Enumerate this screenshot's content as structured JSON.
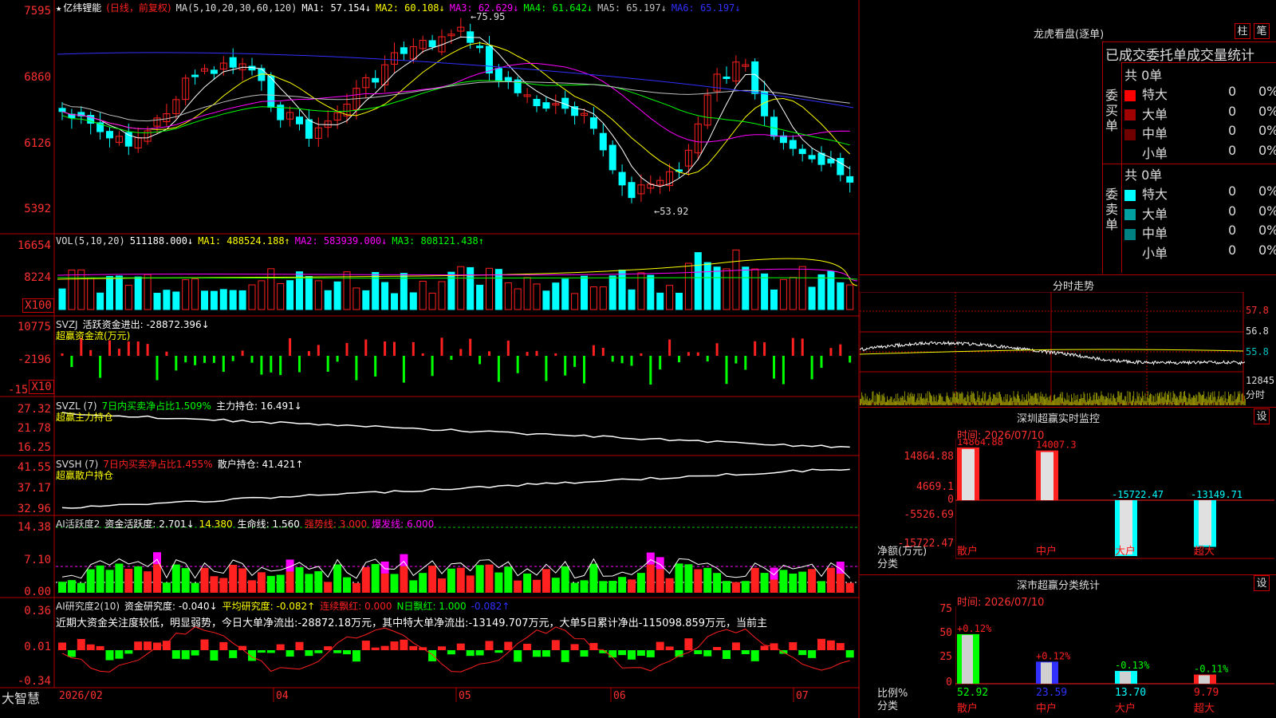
{
  "colors": {
    "up": "#ff2020",
    "down": "#00ffff",
    "bg": "#000000",
    "grid": "#b00000",
    "ma1": "#ffffff",
    "ma2": "#ffff00",
    "ma3": "#ff00ff",
    "ma4": "#00ff00",
    "ma5": "#c0c0c0",
    "ma6": "#3030ff"
  },
  "kline": {
    "title_star": "★",
    "stock": "亿纬锂能",
    "mode": "(日线，前复权)",
    "ma_label": "MA(5,10,20,30,60,120)",
    "ma_values": [
      "MA1: 57.154↓",
      "MA2: 60.108↓",
      "MA3: 62.629↓",
      "MA4: 61.642↓",
      "MA5: 65.197↓",
      "MA6: 65.197↓"
    ],
    "y_ticks": [
      "7595",
      "6860",
      "6126",
      "5392"
    ],
    "high_label": "75.95",
    "low_label": "53.92"
  },
  "vol": {
    "label": "VOL(5,10,20)",
    "value": "511188.000↓",
    "ma": [
      "MA1: 488524.188↑",
      "MA2: 583939.000↓",
      "MA3: 808121.438↑"
    ],
    "y_ticks": [
      "16654",
      "8224"
    ],
    "unit": "X100"
  },
  "svzj": {
    "label": "SVZJ",
    "desc": "活跃资金进出: -28872.396↓",
    "sub": "超赢资金流(万元)",
    "y_ticks": [
      "10775",
      "-2196",
      "-15"
    ],
    "unit": "X10"
  },
  "svzl": {
    "label": "SVZL (7)",
    "desc": "7日内买卖净占比1.509%",
    "hold": "主力持仓: 16.491↓",
    "sub": "超赢主力持仓",
    "y_ticks": [
      "27.32",
      "21.78",
      "16.25"
    ]
  },
  "svsh": {
    "label": "SVSH (7)",
    "desc": "7日内买卖净占比1.455%",
    "hold": "散户持仓: 41.421↑",
    "sub": "超赢散户持仓",
    "y_ticks": [
      "41.55",
      "37.17",
      "32.96"
    ]
  },
  "ai_active": {
    "label": "AI活跃度2",
    "items": [
      "资金活跃度: 2.701↓",
      "14.380",
      "生命线: 1.560",
      "强势线: 3.000",
      "爆发线: 6.000"
    ],
    "y_ticks": [
      "14.38",
      "7.10",
      "0.00"
    ]
  },
  "ai_research": {
    "label": "AI研究度2(10)",
    "items": [
      "资金研究度: -0.040↓",
      "平均研究度: -0.082↑",
      "连续飘红: 0.000",
      "N日飘红: 1.000",
      "-0.082↑"
    ],
    "commentary": "近期大资金关注度较低，明显弱势，今日大单净流出:-28872.18万元，其中特大单净流出:-13149.707万元，大单5日累计净出-115098.859万元，当前主",
    "y_ticks": [
      "0.36",
      "0.01",
      "-0.34"
    ]
  },
  "x_axis": {
    "brand": "大智慧",
    "labels": [
      "2026/02",
      "04",
      "05",
      "06",
      "07"
    ]
  },
  "longhu": {
    "title": "龙虎看盘(逐单)",
    "btn_zhu": "柱",
    "btn_bi": "笔",
    "header": "已成交委托单成交量统计",
    "buy_label": "委买单",
    "sell_label": "委卖单",
    "buy_total": "共 0单",
    "sell_total": "共 0单",
    "buy_rows": [
      {
        "name": "特大",
        "qty": "0",
        "pct": "0%",
        "color": "#ff0000"
      },
      {
        "name": "大单",
        "qty": "0",
        "pct": "0%",
        "color": "#a00000"
      },
      {
        "name": "中单",
        "qty": "0",
        "pct": "0%",
        "color": "#700000"
      },
      {
        "name": "小单",
        "qty": "0",
        "pct": "0%",
        "color": ""
      }
    ],
    "sell_rows": [
      {
        "name": "特大",
        "qty": "0",
        "pct": "0%",
        "color": "#00ffff"
      },
      {
        "name": "大单",
        "qty": "0",
        "pct": "0%",
        "color": "#00a0a0"
      },
      {
        "name": "中单",
        "qty": "0",
        "pct": "0%",
        "color": "#008080"
      },
      {
        "name": "小单",
        "qty": "0",
        "pct": "0%",
        "color": ""
      }
    ]
  },
  "fenshi": {
    "title": "分时走势",
    "right_ticks": [
      "57.8",
      "56.8",
      "55.8",
      "12845"
    ],
    "unit": "分时"
  },
  "monitor": {
    "title": "深圳超赢实时监控",
    "btn": "设",
    "time": "时间: 2026/07/10",
    "y_ticks": [
      "14864.88",
      "4669.1",
      "0",
      "-5526.69",
      "-15722.47"
    ],
    "y_unit": "净额(万元)",
    "x_unit": "分类",
    "categories": [
      "散户",
      "中户",
      "大户",
      "超大"
    ],
    "values": [
      14864.88,
      14007.3,
      -15722.47,
      -13149.71
    ],
    "value_labels": [
      "14864.88",
      "14007.3",
      "-15722.47",
      "-13149.71"
    ]
  },
  "classify": {
    "title": "深市超赢分类统计",
    "btn": "设",
    "time": "时间: 2026/07/10",
    "y_ticks": [
      "75",
      "50",
      "25",
      "0"
    ],
    "y_unit": "比例%",
    "x_unit": "分类",
    "categories": [
      "散户",
      "中户",
      "大户",
      "超大"
    ],
    "values": [
      52.92,
      23.59,
      13.7,
      9.79
    ],
    "value_labels": [
      "52.92",
      "23.59",
      "13.70",
      "9.79"
    ],
    "change_labels": [
      "+0.12%",
      "+0.12%",
      "-0.13%",
      "-0.11%"
    ]
  }
}
